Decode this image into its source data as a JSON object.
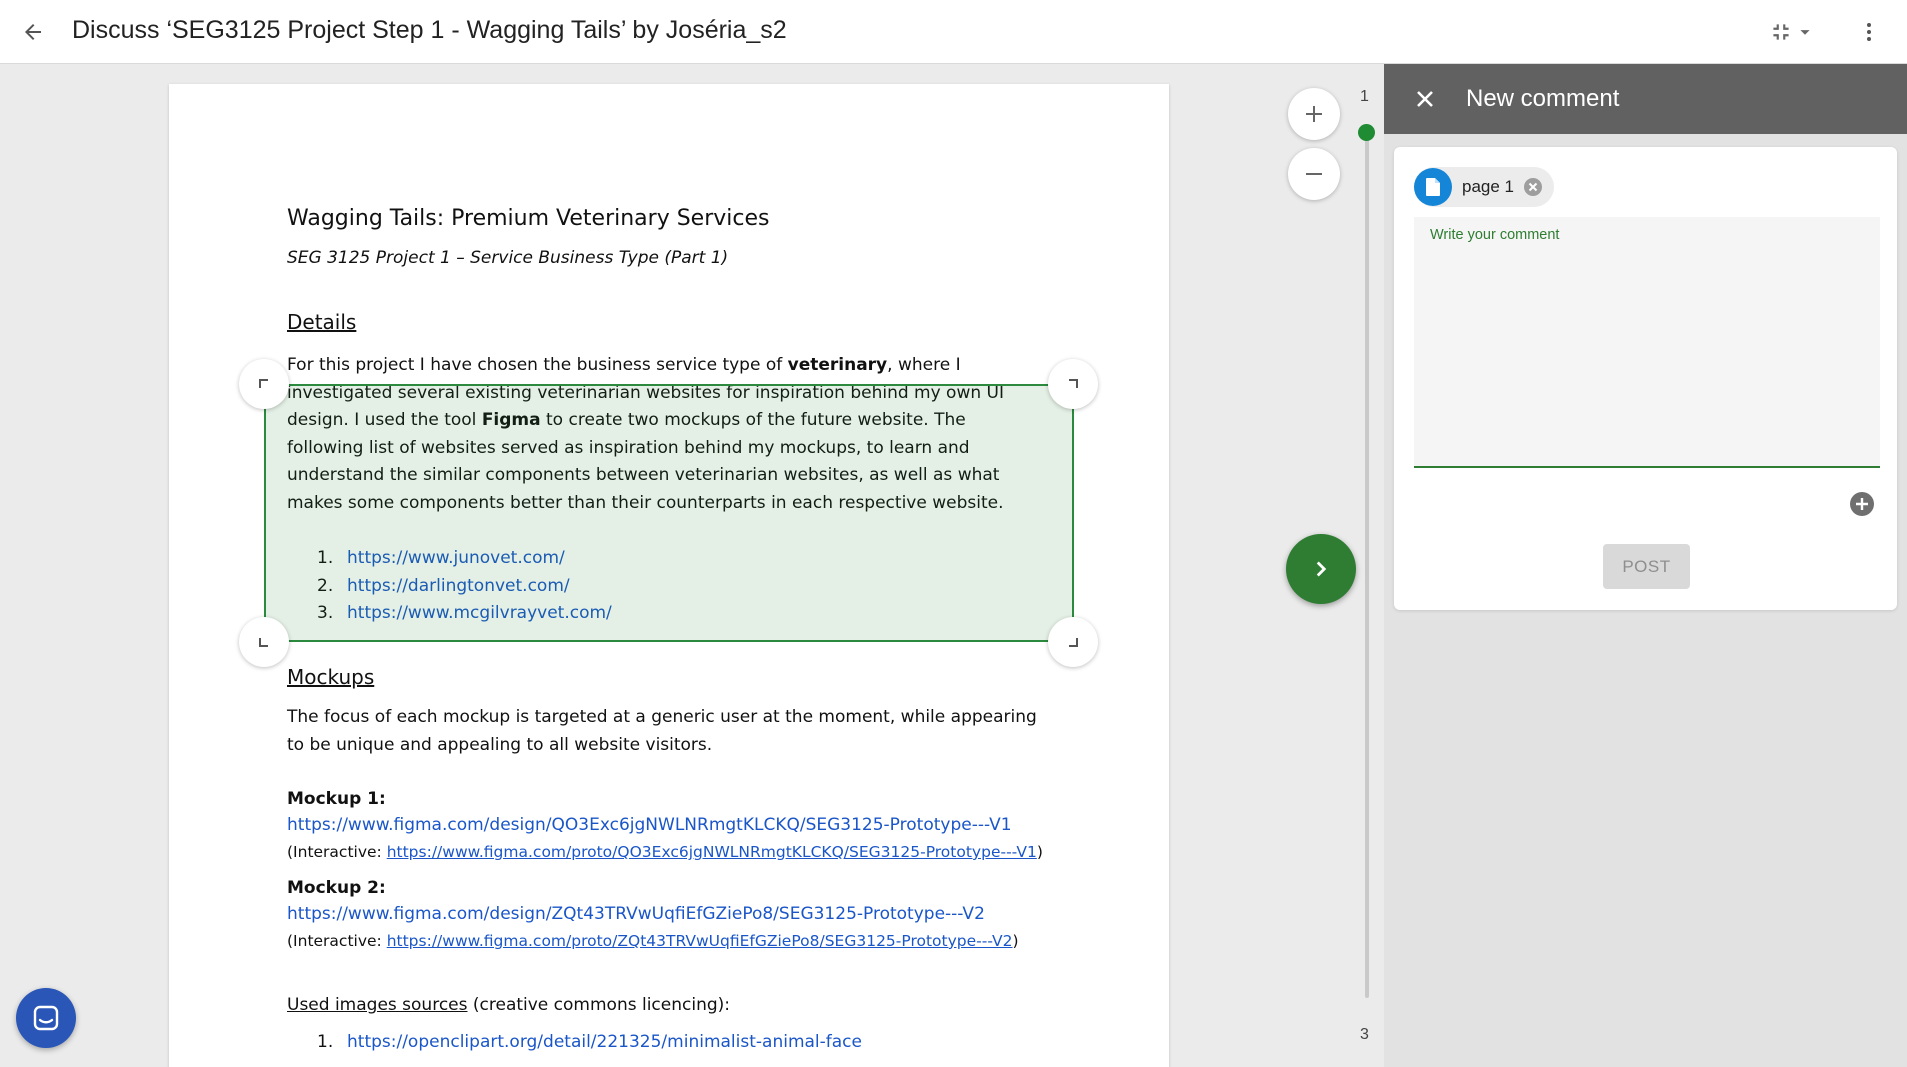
{
  "header": {
    "title": "Discuss ‘SEG3125 Project Step 1 - Wagging Tails’ by Joséria_s2"
  },
  "document": {
    "title": "Wagging Tails: Premium Veterinary Services",
    "subtitle": "SEG 3125 Project 1 – Service Business Type (Part 1)",
    "details_heading": "Details",
    "details_para": {
      "a": "For this project I have chosen the business service type of ",
      "b": "veterinary",
      "c": ", where I investigated several existing veterinarian websites for inspiration behind my own UI design. I used the tool ",
      "d": "Figma",
      "e": " to create two mockups of the future website. The following list of websites served as inspiration behind my mockups, to learn and understand the similar components between veterinarian websites, as well as what makes some components better than their counterparts in each respective website."
    },
    "inspiration_links": [
      {
        "num": "1.",
        "url": "https://www.junovet.com/"
      },
      {
        "num": "2.",
        "url": "https://darlingtonvet.com/"
      },
      {
        "num": "3.",
        "url": "https://www.mcgilvrayvet.com/"
      }
    ],
    "mockups_heading": "Mockups",
    "mockups_para": "The focus of each mockup is targeted at a generic user at the moment, while appearing to be unique and appealing to all website visitors.",
    "mockup1_label": "Mockup 1:",
    "mockup1_url": "https://www.figma.com/design/QO3Exc6jgNWLNRmgtKLCKQ/SEG3125-Prototype---V1",
    "mockup1_interactive_prefix": "(Interactive: ",
    "mockup1_interactive_url": "https://www.figma.com/proto/QO3Exc6jgNWLNRmgtKLCKQ/SEG3125-Prototype---V1",
    "mockup1_interactive_suffix": ")",
    "mockup2_label": "Mockup 2:",
    "mockup2_url": "https://www.figma.com/design/ZQt43TRVwUqfiEfGZiePo8/SEG3125-Prototype---V2",
    "mockup2_interactive_prefix": "(Interactive: ",
    "mockup2_interactive_url": "https://www.figma.com/proto/ZQt43TRVwUqfiEfGZiePo8/SEG3125-Prototype---V2",
    "mockup2_interactive_suffix": ")",
    "images_heading": "Used images sources",
    "images_heading_suffix": " (creative commons licencing):",
    "image_links": [
      {
        "num": "1.",
        "url": "https://openclipart.org/detail/221325/minimalist-animal-face"
      }
    ]
  },
  "pager": {
    "current_page": "1",
    "last_page": "3"
  },
  "panel": {
    "title": "New comment",
    "chip_label": "page 1",
    "comment_placeholder": "Write your comment",
    "comment_value": "",
    "post_label": "POST"
  },
  "colors": {
    "accent_green": "#2e7d32",
    "panel_header": "#616161",
    "link_blue": "#1a56c8",
    "doc_chip_blue": "#1585d8",
    "intercom_blue": "#2a56b8"
  },
  "icons": {
    "back": "arrow-left-icon",
    "fit": "fit-to-page-icon",
    "menu": "more-vert-icon",
    "zoom_in": "plus-icon",
    "zoom_out": "minus-icon",
    "go": "chevron-right-icon",
    "close": "close-icon",
    "doc": "document-icon",
    "chip_remove": "remove-circle-icon",
    "attach": "add-circle-icon",
    "chat": "chat-bubble-icon"
  }
}
